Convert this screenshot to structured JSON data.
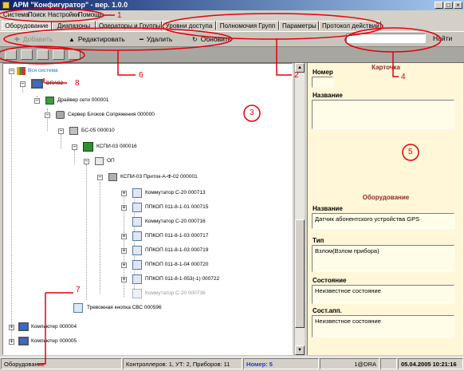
{
  "window": {
    "title": "АРМ \"Конфигуратор\" - вер. 1.0.0"
  },
  "menu": [
    "Система",
    "Поиск",
    "Настройки",
    "Помощь"
  ],
  "tabs": [
    "Оборудование",
    "Диапазоны",
    "Операторы и Группы",
    "Уровни доступа",
    "Полномочия Групп",
    "Параметры",
    "Протокол действий"
  ],
  "toolbar": {
    "add": "Добавить",
    "edit": "Редактировать",
    "delete": "Удалить",
    "refresh": "Обновить",
    "search_value": "",
    "search_button": "Найти"
  },
  "tree": {
    "root": "Вся система",
    "items": [
      "DRA02",
      "Драйвер сети 000001",
      "Сервер Блоков Сопряжения 000000",
      "БС-05 000010",
      "КСПИ-03 000016",
      "ОП",
      "КСПИ-03 Приток-А-Ф-02 000001",
      "Коммутатор С-20 000713",
      "ППКОП 011-8-1-01 000715",
      "Коммутатор С-20 000716",
      "ППКОП 011-8-1-03 000717",
      "ППКОП 011-8-1-03 000719",
      "ППКОП 011-8-1-04 000720",
      "ППКОП 011-8-1-053(-1) 000722",
      "Коммутатор С-20 000736",
      "Тревожная кнопка СВС 000596",
      "Компьютер 000004",
      "Компьютер 000005"
    ]
  },
  "card": {
    "title": "Карточка",
    "number_label": "Номер",
    "number_value": "",
    "name_label": "Название",
    "name_value": "",
    "equipment_title": "Оборудование",
    "eq_name_label": "Название",
    "eq_name_value": "Датчик абонентского устройства GPS",
    "type_label": "Тип",
    "type_value": "Взлом(Взлом прибора)",
    "state_label": "Состояние",
    "state_value": "Неизвестное состояние",
    "hw_state_label": "Сост.апп.",
    "hw_state_value": "Неизвестное состояние"
  },
  "status": {
    "left": "Оборудование",
    "counts": "Контроллеров: 1, УТ: 2, Приборов: 11",
    "number": "Номер: 5",
    "user": "1@DRA",
    "datetime": "05.04.2005 10:21:16"
  },
  "annotations": [
    "1",
    "2",
    "3",
    "4",
    "5",
    "6",
    "7",
    "8"
  ],
  "colors": {
    "annotation": "#e3000b",
    "card_bg": "#fff7d8",
    "title_gradient_start": "#0a246a"
  }
}
